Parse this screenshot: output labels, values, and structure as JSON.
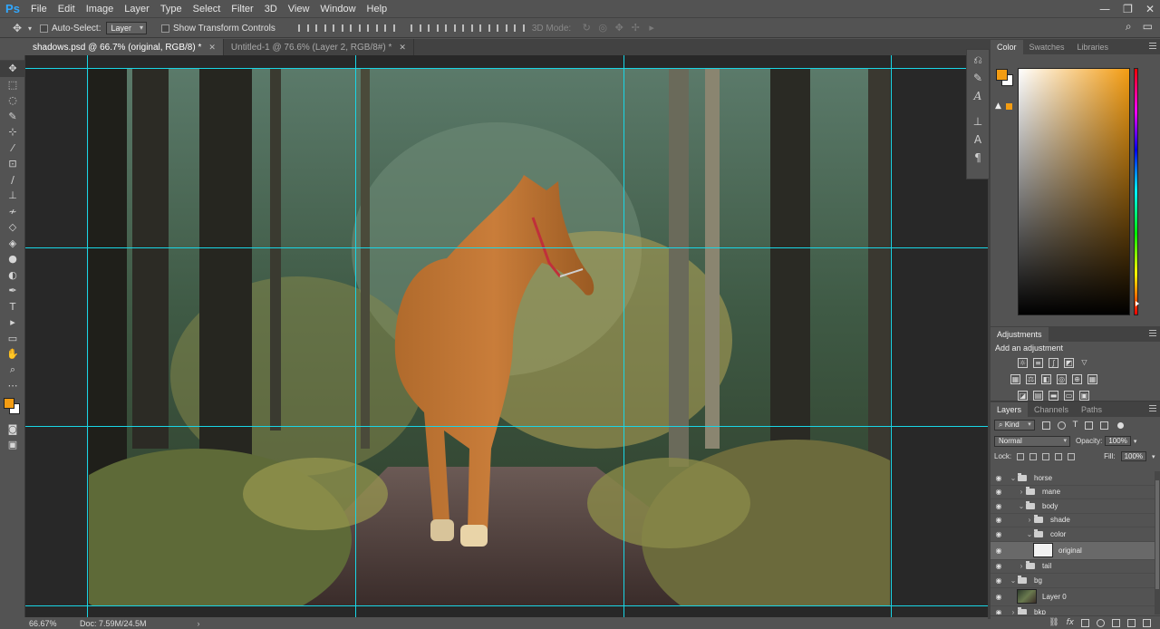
{
  "app": {
    "logo": "Ps"
  },
  "menu": [
    "File",
    "Edit",
    "Image",
    "Layer",
    "Type",
    "Select",
    "Filter",
    "3D",
    "View",
    "Window",
    "Help"
  ],
  "window_controls": {
    "minimize": "—",
    "restore": "❐",
    "close": "✕"
  },
  "options": {
    "auto_select_label": "Auto-Select:",
    "auto_select_value": "Layer",
    "show_transform_label": "Show Transform Controls",
    "three_d_mode_label": "3D Mode:"
  },
  "tabs": [
    {
      "label": "shadows.psd @ 66.7% (original, RGB/8) *",
      "active": true
    },
    {
      "label": "Untitled-1 @ 76.6% (Layer 2, RGB/8#) *",
      "active": false
    }
  ],
  "status": {
    "zoom": "66.67%",
    "doc_size": "Doc: 7.59M/24.5M",
    "arrow": "›"
  },
  "colors": {
    "foreground": "#f39c12",
    "background": "#ffffff",
    "guide": "#19d6e6",
    "web_safe_chip": "#f39c12"
  },
  "panels": {
    "color_tabs": [
      "Color",
      "Swatches",
      "Libraries"
    ],
    "adjustments_tab": "Adjustments",
    "add_adjustment_label": "Add an adjustment",
    "layers_tabs": [
      "Layers",
      "Channels",
      "Paths"
    ],
    "filter_kind": "Kind",
    "blend_mode": "Normal",
    "opacity_label": "Opacity:",
    "opacity_value": "100%",
    "lock_label": "Lock:",
    "fill_label": "Fill:",
    "fill_value": "100%"
  },
  "layers": [
    {
      "name": "horse",
      "type": "group",
      "indent": 0,
      "expanded": true
    },
    {
      "name": "mane",
      "type": "group",
      "indent": 1,
      "expanded": false
    },
    {
      "name": "body",
      "type": "group",
      "indent": 1,
      "expanded": true
    },
    {
      "name": "shade",
      "type": "group",
      "indent": 2,
      "expanded": false
    },
    {
      "name": "color",
      "type": "group",
      "indent": 2,
      "expanded": true
    },
    {
      "name": "original",
      "type": "layer",
      "indent": 3,
      "selected": true,
      "thumb": "white"
    },
    {
      "name": "tail",
      "type": "group",
      "indent": 1,
      "expanded": false
    },
    {
      "name": "bg",
      "type": "group",
      "indent": 0,
      "expanded": true
    },
    {
      "name": "Layer 0",
      "type": "layer",
      "indent": 1,
      "thumb": "photo"
    },
    {
      "name": "bkp",
      "type": "group",
      "indent": 0,
      "expanded": false
    }
  ],
  "layers_bottom_fx": "fx"
}
